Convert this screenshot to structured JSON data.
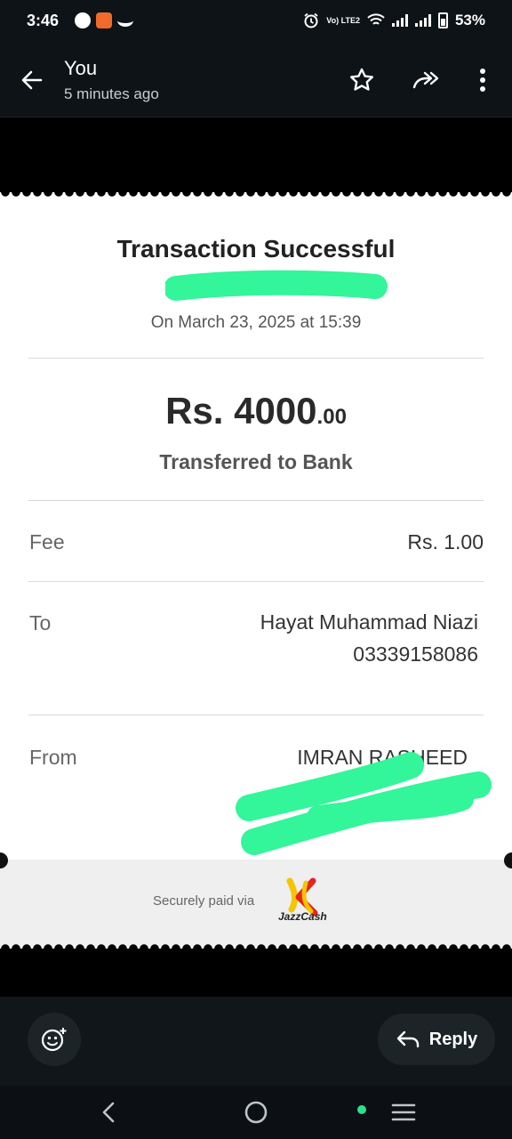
{
  "status_bar": {
    "time": "3:46",
    "network": "Vo) LTE2",
    "battery": "53%"
  },
  "header": {
    "title": "You",
    "subtitle": "5 minutes ago"
  },
  "receipt": {
    "title": "Transaction Successful",
    "date": "On March 23, 2025 at 15:39",
    "amount_main": "Rs. 4000",
    "amount_decimal": ".00",
    "transfer_type": "Transferred to Bank",
    "fee_label": "Fee",
    "fee_value": "Rs. 1.00",
    "to_label": "To",
    "to_name": "Hayat Muhammad Niazi",
    "to_number": "03339158086",
    "from_label": "From",
    "from_name": "IMRAN RASHEED",
    "paid_via": "Securely paid via",
    "brand": "JazzCash"
  },
  "bottom": {
    "reply_label": "Reply"
  },
  "colors": {
    "highlight": "#33f59a",
    "accent_green": "#2ee08d",
    "jazzcash_yellow": "#f6c400",
    "jazzcash_red": "#e5251b"
  },
  "icons": [
    "back-arrow-icon",
    "star-icon",
    "forward-icon",
    "more-vert-icon",
    "emoji-add-icon",
    "reply-icon",
    "nav-back-icon",
    "nav-home-icon",
    "nav-menu-icon"
  ]
}
